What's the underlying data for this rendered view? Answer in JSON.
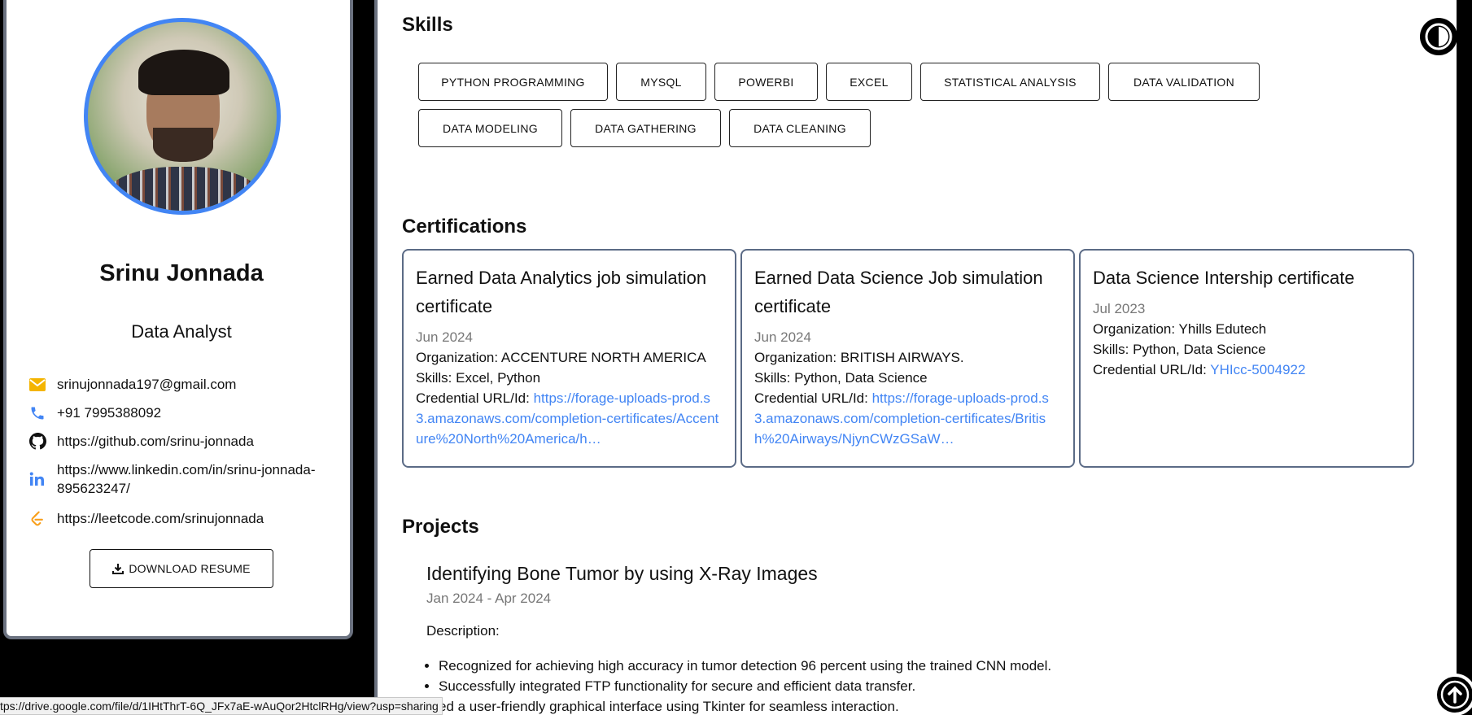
{
  "profile": {
    "name": "Srinu Jonnada",
    "title": "Data Analyst",
    "email": "srinujonnada197@gmail.com",
    "phone": "+91 7995388092",
    "github": "https://github.com/srinu-jonnada",
    "linkedin": "https://www.linkedin.com/in/srinu-jonnada-895623247/",
    "leetcode": "https://leetcode.com/srinujonnada",
    "download_label": "DOWNLOAD RESUME"
  },
  "skills": {
    "heading": "Skills",
    "items": [
      "PYTHON PROGRAMMING",
      "MYSQL",
      "POWERBI",
      "EXCEL",
      "STATISTICAL ANALYSIS",
      "DATA VALIDATION",
      "DATA MODELING",
      "DATA GATHERING",
      "DATA CLEANING"
    ]
  },
  "certifications": {
    "heading": "Certifications",
    "items": [
      {
        "title": "Earned Data Analytics job simulation certificate",
        "date": "Jun 2024",
        "organization": "Organization: ACCENTURE NORTH AMERICA",
        "skills": "Skills: Excel, Python",
        "credential_label": "Credential URL/Id:",
        "credential_url": "https://forage-uploads-prod.s3.amazonaws.com/completion-certificates/Accenture%20North%20America/h…"
      },
      {
        "title": "Earned Data Science Job simulation certificate",
        "date": "Jun 2024",
        "organization": "Organization: BRITISH AIRWAYS.",
        "skills": "Skills: Python, Data Science",
        "credential_label": "Credential URL/Id:",
        "credential_url": "https://forage-uploads-prod.s3.amazonaws.com/completion-certificates/British%20Airways/NjynCWzGSaW…"
      },
      {
        "title": "Data Science Intership certificate",
        "date": "Jul 2023",
        "organization": "Organization: Yhills Edutech",
        "skills": "Skills: Python, Data Science",
        "credential_label": "Credential URL/Id:",
        "credential_url": "YHIcc-5004922"
      }
    ]
  },
  "projects": {
    "heading": "Projects",
    "items": [
      {
        "title": "Identifying Bone Tumor by using X-Ray Images",
        "date": "Jan 2024 - Apr 2024",
        "description_label": "Description:",
        "bullets": [
          "Recognized for achieving high accuracy in tumor detection 96 percent using the trained CNN model.",
          "Successfully integrated FTP functionality for secure and efficient data transfer.",
          "ed a user-friendly graphical interface using Tkinter for seamless interaction."
        ]
      }
    ]
  },
  "status_bar": {
    "url": "tps://drive.google.com/file/d/1IHtThrT-6Q_JFx7aE-wAuQor2HtclRHg/view?usp=sharing"
  },
  "colors": {
    "accent": "#4285f4",
    "card_border": "#5b6b86",
    "email_icon": "#f4b400",
    "leetcode_icon": "#f89f1b"
  }
}
